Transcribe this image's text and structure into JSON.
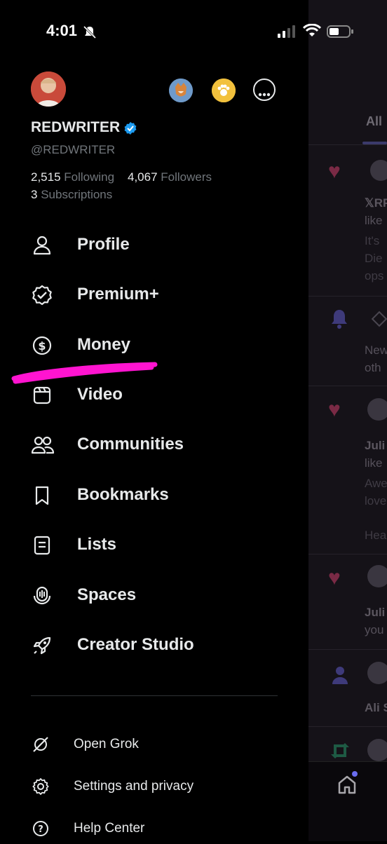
{
  "status_bar": {
    "time": "4:01"
  },
  "profile": {
    "display_name": "REDWRITER",
    "handle": "@REDWRITER",
    "following_count": "2,515",
    "following_label": "Following",
    "followers_count": "4,067",
    "followers_label": "Followers",
    "subscriptions_count": "3",
    "subscriptions_label": "Subscriptions"
  },
  "menu": [
    {
      "label": "Profile",
      "icon": "person-icon"
    },
    {
      "label": "Premium+",
      "icon": "verified-badge-icon"
    },
    {
      "label": "Money",
      "icon": "dollar-circle-icon"
    },
    {
      "label": "Video",
      "icon": "video-icon"
    },
    {
      "label": "Communities",
      "icon": "communities-icon"
    },
    {
      "label": "Bookmarks",
      "icon": "bookmark-icon"
    },
    {
      "label": "Lists",
      "icon": "list-icon"
    },
    {
      "label": "Spaces",
      "icon": "spaces-icon"
    },
    {
      "label": "Creator Studio",
      "icon": "rocket-icon"
    }
  ],
  "secondary_menu": [
    {
      "label": "Open Grok",
      "icon": "grok-icon"
    },
    {
      "label": "Settings and privacy",
      "icon": "gear-icon"
    },
    {
      "label": "Help Center",
      "icon": "help-icon"
    }
  ],
  "background": {
    "tab_label": "All",
    "snippets": [
      "𝕏RP",
      "like",
      "It's",
      "Die",
      "ops",
      "New",
      "oth",
      "Juli",
      "like",
      "Awe",
      "love",
      "Hea",
      "Juli",
      "you",
      "Ali S"
    ]
  },
  "colors": {
    "background": "#000000",
    "text": "#e7e9ea",
    "muted": "#71767b",
    "verified": "#1d9bf0",
    "annotation_stroke": "#ff00cc"
  }
}
